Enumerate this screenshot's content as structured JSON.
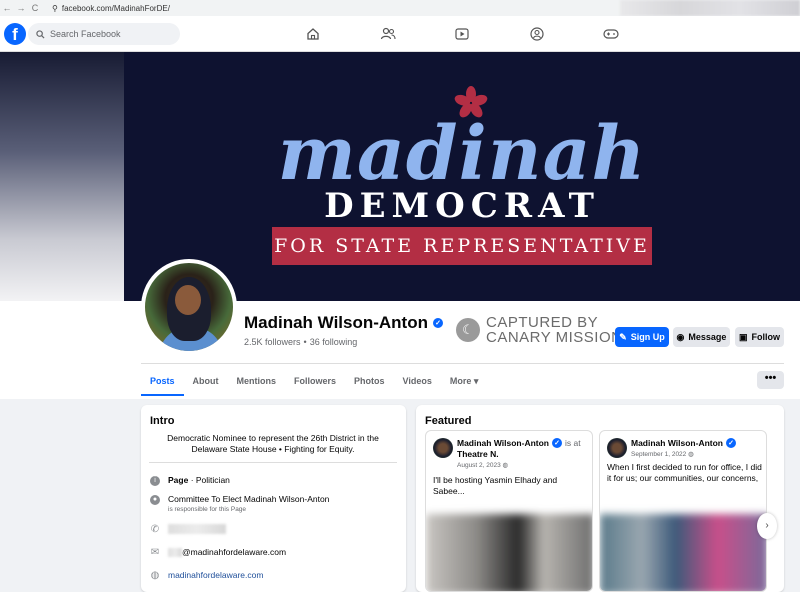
{
  "browser": {
    "url": "facebook.com/MadinahForDE/",
    "back": "←",
    "forward": "→",
    "reload": "C"
  },
  "topbar": {
    "logo": "f",
    "search_placeholder": "Search Facebook",
    "nav_icons": [
      "home-icon",
      "friends-icon",
      "video-icon",
      "groups-icon",
      "gaming-icon"
    ]
  },
  "cover": {
    "name": "madinah",
    "party": "DEMOCRAT",
    "office": "FOR STATE REPRESENTATIVE",
    "colors": {
      "background": "#0e1230",
      "name": "#8fb4ee",
      "banner": "#b32e44",
      "flower": "#b32e44"
    }
  },
  "profile": {
    "name": "Madinah Wilson-Anton",
    "followers": "2.5K followers",
    "separator": "•",
    "following": "36 following"
  },
  "watermark": {
    "line1": "CAPTURED BY",
    "line2": "CANARY MISSION"
  },
  "actions": {
    "signup": "Sign Up",
    "message": "Message",
    "follow": "Follow",
    "more": "•••"
  },
  "tabs": [
    {
      "label": "Posts",
      "active": true
    },
    {
      "label": "About"
    },
    {
      "label": "Mentions"
    },
    {
      "label": "Followers"
    },
    {
      "label": "Photos"
    },
    {
      "label": "Videos"
    },
    {
      "label": "More ▾"
    }
  ],
  "intro": {
    "title": "Intro",
    "bio": "Democratic Nominee to represent the 26th District in the Delaware State House • Fighting for Equity.",
    "page_label": "Page",
    "page_category": " · Politician",
    "responsible_name": "Committee To Elect Madinah Wilson-Anton",
    "responsible_sub": "is responsible for this Page",
    "email_suffix": "@madinahfordelaware.com",
    "website": "madinahfordelaware.com"
  },
  "featured": {
    "title": "Featured",
    "posts": [
      {
        "author": "Madinah Wilson-Anton",
        "meta": "is at",
        "location": "Theatre N.",
        "date": "August 2, 2023",
        "text": "I'll be hosting Yasmin Elhady and Sabee..."
      },
      {
        "author": "Madinah Wilson-Anton",
        "date": "September 1, 2022",
        "text": "When I first decided to run for office, I did it for us; our communities, our concerns,"
      }
    ]
  },
  "accent": "#0866ff"
}
